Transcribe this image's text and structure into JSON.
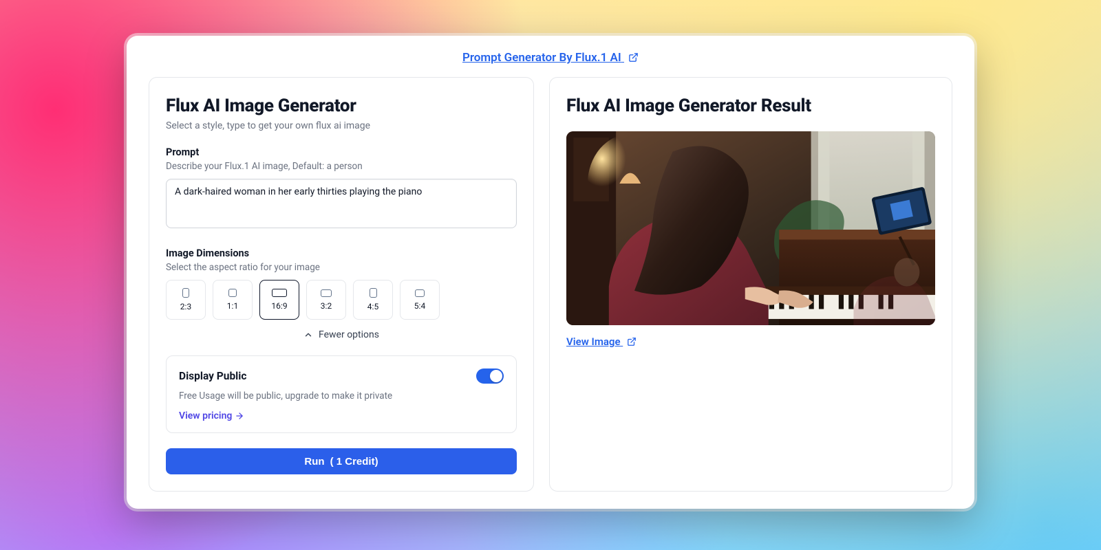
{
  "header": {
    "link_text": "Prompt Generator By Flux.1 AI"
  },
  "left": {
    "title": "Flux AI Image Generator",
    "subtitle": "Select a style, type to get your own flux ai image",
    "prompt_label": "Prompt",
    "prompt_help": "Describe your Flux.1 AI image, Default: a person",
    "prompt_value": "A dark-haired woman in her early thirties playing the piano",
    "dim_label": "Image Dimensions",
    "dim_help": "Select the aspect ratio for your image",
    "ratios": [
      {
        "label": "2:3",
        "w": 10,
        "h": 14,
        "selected": false
      },
      {
        "label": "1:1",
        "w": 12,
        "h": 12,
        "selected": false
      },
      {
        "label": "16:9",
        "w": 22,
        "h": 12,
        "selected": true
      },
      {
        "label": "3:2",
        "w": 16,
        "h": 11,
        "selected": false
      },
      {
        "label": "4:5",
        "w": 11,
        "h": 14,
        "selected": false
      },
      {
        "label": "5:4",
        "w": 14,
        "h": 11,
        "selected": false
      }
    ],
    "fewer_label": "Fewer options",
    "public": {
      "title": "Display Public",
      "help": "Free Usage will be public, upgrade to make it private",
      "pricing_label": "View pricing",
      "on": true
    },
    "run": {
      "label": "Run",
      "credits": "( 1 Credit)"
    }
  },
  "right": {
    "title": "Flux AI Image Generator Result",
    "view_label": "View Image"
  },
  "colors": {
    "primary": "#2563eb",
    "indigo": "#4f46e5"
  }
}
